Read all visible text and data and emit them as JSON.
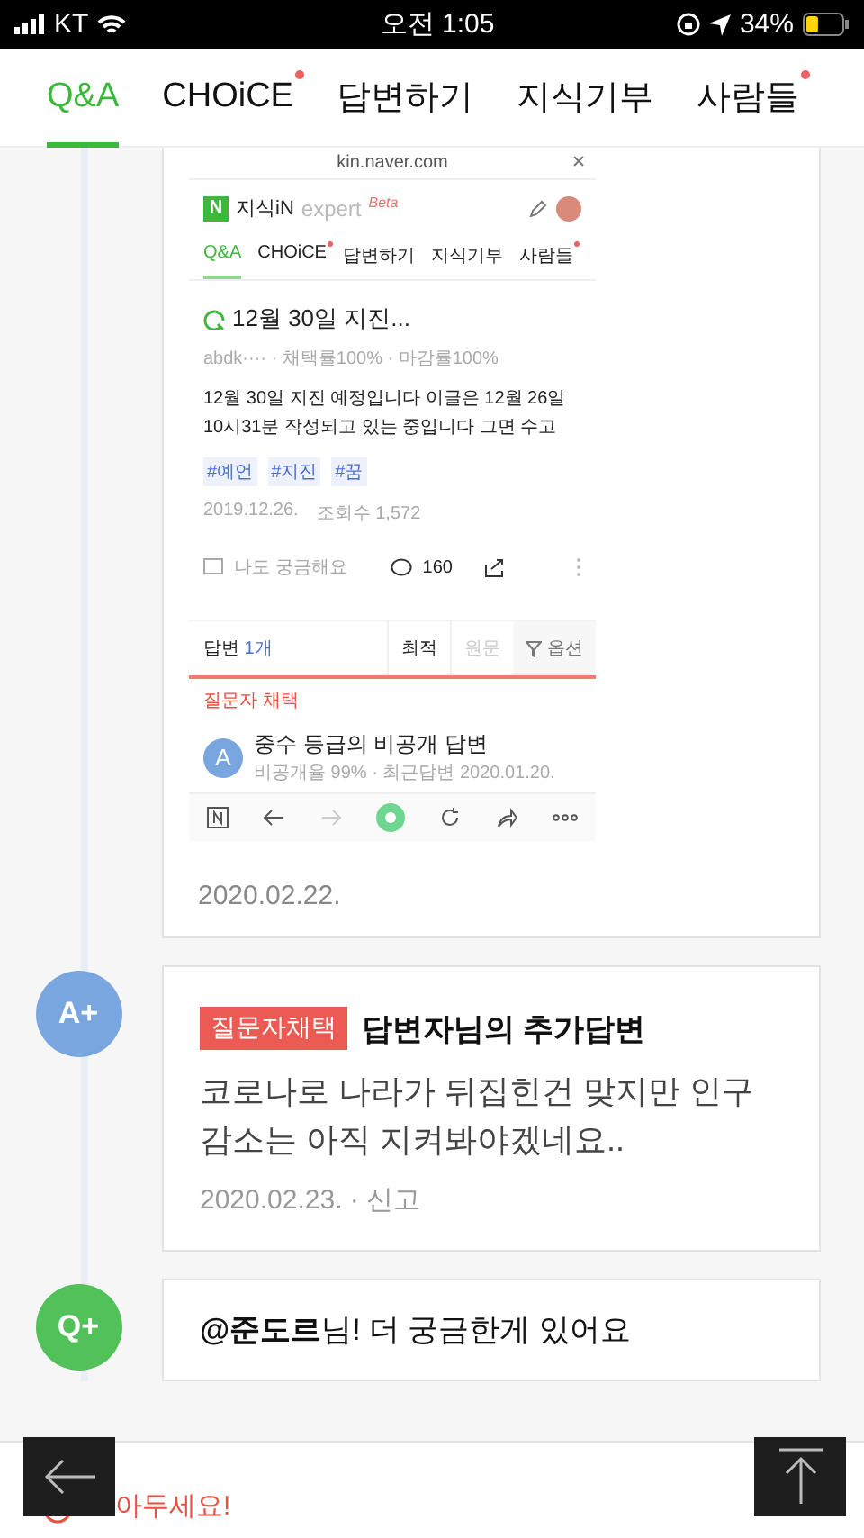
{
  "status_bar": {
    "carrier": "KT",
    "time": "오전 1:05",
    "battery": "34%"
  },
  "tabs": [
    {
      "label": "Q&A",
      "selected": true,
      "new": false
    },
    {
      "label": "CHOiCE",
      "selected": false,
      "new": true
    },
    {
      "label": "답변하기",
      "selected": false,
      "new": false
    },
    {
      "label": "지식기부",
      "selected": false,
      "new": false
    },
    {
      "label": "사람들",
      "selected": false,
      "new": true
    }
  ],
  "first_card": {
    "screenshot": {
      "url": "kin.naver.com",
      "logo": "N",
      "brand": "지식iN",
      "expert": "expert",
      "beta": "Beta",
      "tabs": [
        {
          "label": "Q&A",
          "selected": true,
          "new": false
        },
        {
          "label": "CHOiCE",
          "selected": false,
          "new": true
        },
        {
          "label": "답변하기",
          "selected": false,
          "new": false
        },
        {
          "label": "지식기부",
          "selected": false,
          "new": false
        },
        {
          "label": "사람들",
          "selected": false,
          "new": true
        }
      ],
      "question_title": "12월 30일 지진...",
      "meta": "abdk···· · 채택률100% · 마감률100%",
      "body": "12월 30일 지진 예정입니다 이글은 12월 26일 10시31분 작성되고 있는 중입니다 그면 수고",
      "tags": [
        "#예언",
        "#지진",
        "#꿈"
      ],
      "date": "2019.12.26.",
      "views": "조회수 1,572",
      "curious": "나도 궁금해요",
      "comments": "160",
      "answers_label": "답변",
      "answers_count": "1개",
      "sorts": [
        {
          "label": "최적",
          "disabled": false
        },
        {
          "label": "원문",
          "disabled": true
        }
      ],
      "filter": "옵션",
      "chosen_label": "질문자 채택",
      "answer": {
        "avatar": "A",
        "title": "중수 등급의 비공개 답변",
        "meta": "비공개율 99% · 최근답변 2020.01.20."
      }
    },
    "date": "2020.02.22."
  },
  "entries": [
    {
      "kind": "answer",
      "avatar": "A+",
      "badge": "질문자채택",
      "title": "답변자님의 추가답변",
      "body": "코로나로 나라가 뒤집힌건 맞지만 인구 감소는 아직 지켜봐야겠네요..",
      "date": "2020.02.23.",
      "separator": "·",
      "report": "신고"
    },
    {
      "kind": "question",
      "avatar": "Q+",
      "text": "**@준도르**님! 더 궁금한게 있어요"
    }
  ],
  "notice": "아두세요!"
}
